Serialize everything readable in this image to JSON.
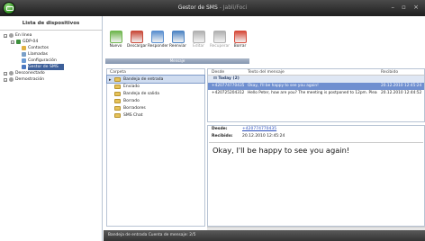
{
  "window": {
    "title": "Gestor de SMS",
    "subtitle": "- Jabli/Foci",
    "controls": "– ▫ ×"
  },
  "sidebar": {
    "heading": "Lista de dispositivos",
    "tree": [
      {
        "label": "En línea",
        "level": 0
      },
      {
        "label": "GDP-04",
        "level": 1
      },
      {
        "label": "Contactos",
        "level": 2
      },
      {
        "label": "Llamadas",
        "level": 2
      },
      {
        "label": "Configuración",
        "level": 2
      },
      {
        "label": "Gestor de SMS",
        "level": 2,
        "selected": true
      },
      {
        "label": "Desconectado",
        "level": 0
      },
      {
        "label": "Demostración",
        "level": 0
      }
    ]
  },
  "toolbar": {
    "buttons": [
      {
        "label": "Nuevo",
        "color": "#6fb64e"
      },
      {
        "label": "Descargar",
        "color": "#c94a3a"
      },
      {
        "label": "Responder",
        "color": "#5a8fd0"
      },
      {
        "label": "Reenviar",
        "color": "#4d84c4"
      },
      {
        "label": "Editar",
        "color": "#b0b0b0",
        "disabled": true
      },
      {
        "label": "Recuperar",
        "color": "#b0b0b0",
        "disabled": true
      },
      {
        "label": "Borrar",
        "color": "#d64a3a"
      }
    ],
    "group_label": "Mensaje"
  },
  "folders": {
    "header": "Carpeta",
    "items": [
      {
        "label": "Bandeja de entrada",
        "selected": true
      },
      {
        "label": "Enviado"
      },
      {
        "label": "Bandeja de salida"
      },
      {
        "label": "Borrado"
      },
      {
        "label": "Borradores"
      },
      {
        "label": "SMS Chat"
      }
    ]
  },
  "messages": {
    "columns": [
      "Desde",
      "Texto del mensaje",
      "Recibido"
    ],
    "group": "Today (2)",
    "rows": [
      {
        "from": "+420774770435",
        "text": "Okay, I'll be happy to see you again!",
        "received": "20.12.2010 12:45:24",
        "selected": true
      },
      {
        "from": "+420725204312",
        "text": "Hello Peter, how are you? The meeting is postponed to 12pm. Please...",
        "received": "20.12.2010 12:44:52"
      }
    ]
  },
  "details": {
    "from_label": "Desde:",
    "from_value": "+420774770435",
    "received_label": "Recibido:",
    "received_value": "20.12.2010 12:45:24",
    "body": "Okay, I'll be happy to see you again!"
  },
  "status": {
    "text": "Bandeja de entrada   Cuenta de mensaje: 2/5"
  }
}
